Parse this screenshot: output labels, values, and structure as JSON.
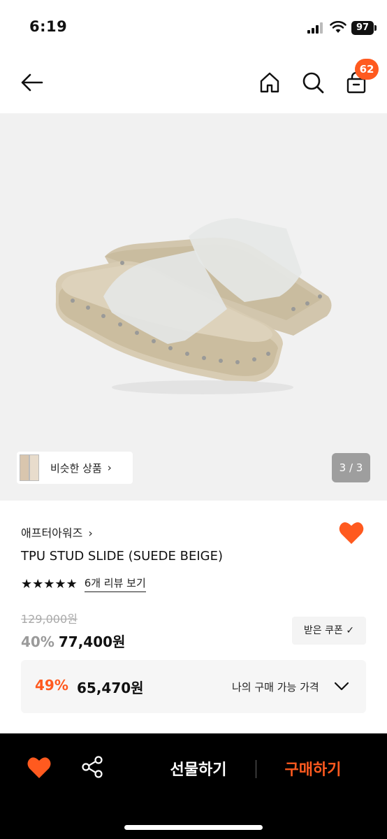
{
  "status": {
    "time": "6:19",
    "battery": "97"
  },
  "nav": {
    "cart_count": "62"
  },
  "gallery": {
    "similar_label": "비슷한 상품",
    "counter": "3 / 3"
  },
  "product": {
    "brand": "애프터아워즈",
    "name": "TPU STUD SLIDE (SUEDE BEIGE)",
    "rating_stars": "★★★★★",
    "review_link": "6개 리뷰 보기",
    "original_price": "129,000원",
    "discount": "40%",
    "sale_price": "77,400원",
    "coupon_label": "받은 쿠폰 ✓"
  },
  "best": {
    "discount": "49%",
    "price": "65,470원",
    "label": "나의 구매 가능 가격"
  },
  "bottom": {
    "gift_label": "선물하기",
    "buy_label": "구매하기"
  },
  "colors": {
    "accent": "#ff5a1f",
    "hero_bg": "#f1f1f1",
    "bottom_bg": "#000000"
  }
}
